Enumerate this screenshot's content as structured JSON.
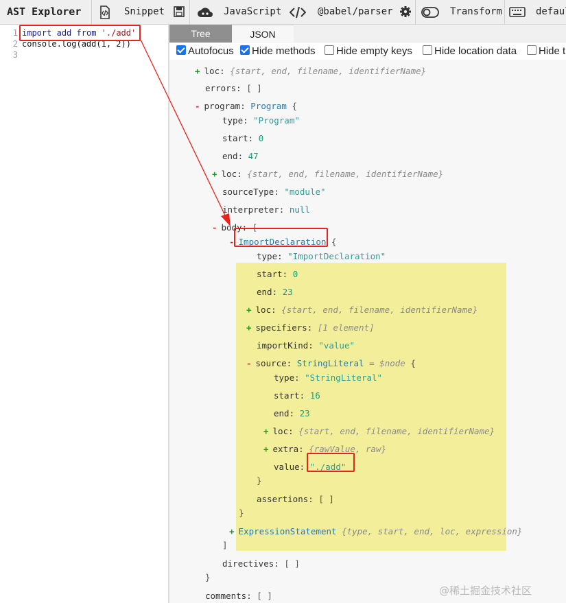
{
  "toolbar": {
    "title": "AST Explorer",
    "snippet": "Snippet",
    "language": "JavaScript",
    "parser": "@babel/parser",
    "transform": "Transform",
    "keymap": "defaul"
  },
  "editor": {
    "lines": [
      {
        "num": "1",
        "tokens": [
          [
            "kw",
            "import"
          ],
          [
            "plain",
            " "
          ],
          [
            "kw",
            "add"
          ],
          [
            "plain",
            " "
          ],
          [
            "kw",
            "from"
          ],
          [
            "plain",
            " "
          ],
          [
            "str",
            "'./add'"
          ]
        ]
      },
      {
        "num": "2",
        "tokens": [
          [
            "plain",
            "console.log(add(1, 2))"
          ]
        ]
      },
      {
        "num": "3",
        "tokens": []
      }
    ]
  },
  "tabs": {
    "tree": "Tree",
    "json": "JSON"
  },
  "options": [
    {
      "label": "Autofocus",
      "checked": true
    },
    {
      "label": "Hide methods",
      "checked": true
    },
    {
      "label": "Hide empty keys",
      "checked": false
    },
    {
      "label": "Hide location data",
      "checked": false
    },
    {
      "label": "Hide t",
      "checked": false
    }
  ],
  "tree_rows": [
    {
      "toggle": "+",
      "parts": [
        [
          "key",
          "loc: "
        ],
        [
          "it",
          "{start, end, filename, identifierName}"
        ]
      ]
    },
    {
      "toggle": "",
      "parts": [
        [
          "key",
          "errors: "
        ],
        [
          "brk",
          " [ ]"
        ]
      ]
    },
    {
      "toggle": "-",
      "parts": [
        [
          "key",
          "program: "
        ],
        [
          "typ",
          " Program"
        ],
        [
          "brk",
          "   {"
        ]
      ]
    },
    {
      "toggle": "",
      "parts": [
        [
          "key",
          "type: "
        ],
        [
          "sv",
          " \"Program\""
        ]
      ]
    },
    {
      "toggle": "",
      "parts": [
        [
          "key",
          "start: "
        ],
        [
          "num",
          " 0"
        ]
      ]
    },
    {
      "toggle": "",
      "parts": [
        [
          "key",
          "end: "
        ],
        [
          "num",
          " 47"
        ]
      ]
    },
    {
      "toggle": "+",
      "parts": [
        [
          "key",
          "loc: "
        ],
        [
          "it",
          " {start, end, filename, identifierName}"
        ]
      ]
    },
    {
      "toggle": "",
      "parts": [
        [
          "key",
          "sourceType: "
        ],
        [
          "sv",
          " \"module\""
        ]
      ]
    },
    {
      "toggle": "",
      "parts": [
        [
          "key",
          "interpreter: "
        ],
        [
          "nul",
          " null"
        ]
      ]
    },
    {
      "toggle": "-",
      "parts": [
        [
          "key",
          "body: "
        ],
        [
          "brk",
          "   ["
        ]
      ]
    },
    {
      "toggle": "-",
      "parts": [
        [
          "typ",
          "ImportDeclaration"
        ],
        [
          "brk",
          "   {"
        ]
      ]
    },
    {
      "toggle": "",
      "parts": [
        [
          "key",
          "type: "
        ],
        [
          "sv",
          " \"ImportDeclaration\""
        ]
      ]
    },
    {
      "toggle": "",
      "parts": [
        [
          "key",
          "start: "
        ],
        [
          "num",
          " 0"
        ]
      ]
    },
    {
      "toggle": "",
      "parts": [
        [
          "key",
          "end: "
        ],
        [
          "num",
          " 23"
        ]
      ]
    },
    {
      "toggle": "+",
      "parts": [
        [
          "key",
          "loc: "
        ],
        [
          "it",
          " {start, end, filename, identifierName}"
        ]
      ]
    },
    {
      "toggle": "+",
      "parts": [
        [
          "key",
          "specifiers: "
        ],
        [
          "it",
          " [1 element]"
        ]
      ]
    },
    {
      "toggle": "",
      "parts": [
        [
          "key",
          "importKind: "
        ],
        [
          "sv",
          " \"value\""
        ]
      ]
    },
    {
      "toggle": "-",
      "parts": [
        [
          "key",
          "source: "
        ],
        [
          "typ",
          " StringLiteral"
        ],
        [
          "it",
          "  = $node"
        ],
        [
          "brk",
          "  {"
        ]
      ]
    },
    {
      "toggle": "",
      "parts": [
        [
          "key",
          "type: "
        ],
        [
          "sv",
          " \"StringLiteral\""
        ]
      ]
    },
    {
      "toggle": "",
      "parts": [
        [
          "key",
          "start: "
        ],
        [
          "num",
          " 16"
        ]
      ]
    },
    {
      "toggle": "",
      "parts": [
        [
          "key",
          "end: "
        ],
        [
          "num",
          " 23"
        ]
      ]
    },
    {
      "toggle": "+",
      "parts": [
        [
          "key",
          "loc: "
        ],
        [
          "it",
          " {start, end, filename, identifierName}"
        ]
      ]
    },
    {
      "toggle": "+",
      "parts": [
        [
          "key",
          "extra: "
        ],
        [
          "it",
          " {rawValue, raw}"
        ]
      ]
    },
    {
      "toggle": "",
      "parts": [
        [
          "key",
          "value: "
        ],
        [
          "sv",
          "  \"./add\""
        ]
      ]
    },
    {
      "toggle": "",
      "parts": [
        [
          "brk",
          "}"
        ]
      ]
    },
    {
      "toggle": "",
      "parts": [
        [
          "key",
          "assertions: "
        ],
        [
          "brk",
          " [ ]"
        ]
      ]
    },
    {
      "toggle": "",
      "parts": [
        [
          "brk",
          "}"
        ]
      ]
    },
    {
      "toggle": "+",
      "parts": [
        [
          "typ",
          "ExpressionStatement"
        ],
        [
          "it",
          " {type, start, end, loc, expression}"
        ]
      ]
    },
    {
      "toggle": "",
      "parts": [
        [
          "brk",
          "]"
        ]
      ]
    },
    {
      "toggle": "",
      "parts": [
        [
          "key",
          "directives: "
        ],
        [
          "brk",
          " [ ]"
        ]
      ]
    },
    {
      "toggle": "",
      "parts": [
        [
          "brk",
          "}"
        ]
      ]
    },
    {
      "toggle": "",
      "parts": [
        [
          "key",
          "comments: "
        ],
        [
          "brk",
          " [ ]"
        ]
      ]
    },
    {
      "toggle": "",
      "parts": [
        [
          "brk",
          "}"
        ]
      ]
    }
  ],
  "watermark": "@稀土掘金技术社区",
  "colors": {
    "annotation": "#e8231b",
    "highlight": "#f3ee99",
    "active_tab": "#8f8f8f"
  }
}
